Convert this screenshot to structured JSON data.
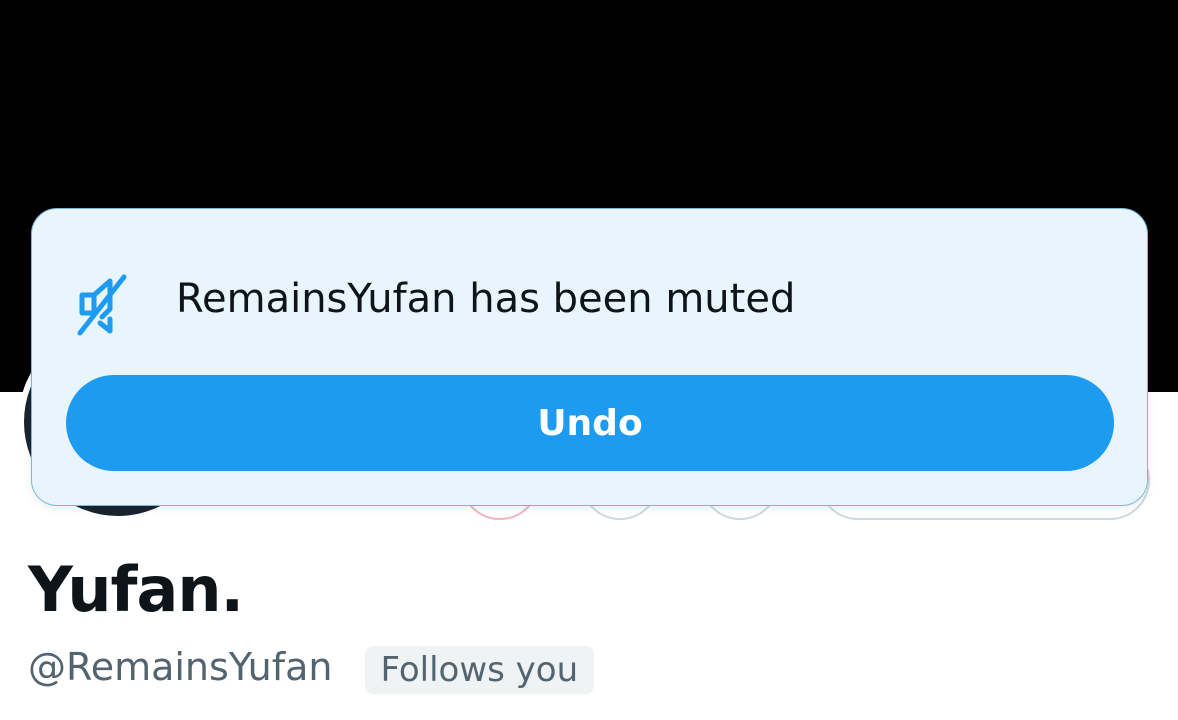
{
  "toast": {
    "icon": "mute-icon",
    "message": "RemainsYufan has been muted",
    "undo_label": "Undo",
    "accent_color": "#1d9bf0"
  },
  "profile": {
    "display_name": "Yufan.",
    "handle": "@RemainsYufan",
    "follows_you_label": "Follows you"
  }
}
